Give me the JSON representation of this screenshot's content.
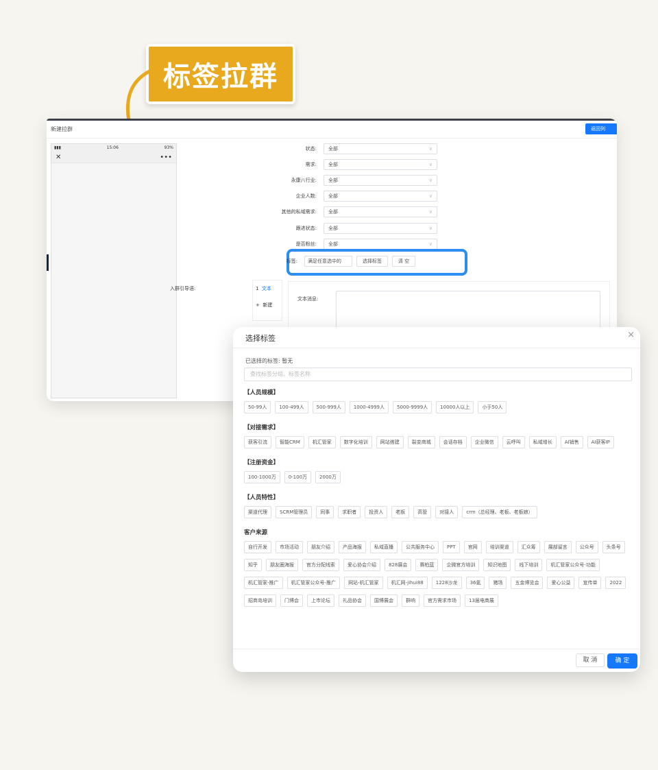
{
  "callout": {
    "text": "标签拉群"
  },
  "window": {
    "title": "新建拉群",
    "back_button": "返回列",
    "phone": {
      "time": "15:06",
      "battery": "93%",
      "close": "✕",
      "more": "•••"
    },
    "filters": [
      {
        "label": "状态:",
        "value": "全部"
      },
      {
        "label": "需求:",
        "value": "全部"
      },
      {
        "label": "永康八行业:",
        "value": "全部"
      },
      {
        "label": "企业人数:",
        "value": "全部"
      },
      {
        "label": "其他的私域需求:",
        "value": "全部"
      },
      {
        "label": "跟进状态:",
        "value": "全部"
      },
      {
        "label": "是否粉丝:",
        "value": "全部"
      }
    ],
    "tag_row": {
      "label": "标签:",
      "mode": "满足任意选中的",
      "select_button": "选择标签",
      "clear_button": "清 空"
    },
    "guide": {
      "label": "入群引导语:",
      "item_index": "1",
      "item_type": "文本",
      "add_label": "新建",
      "text_label": "文本消息:"
    }
  },
  "dialog": {
    "title": "选择标签",
    "close": "×",
    "selected_label": "已选择的标签:",
    "selected_value": "暂无",
    "search_placeholder": "查找标签分组、标签名称",
    "groups": [
      {
        "name": "【人员规模】",
        "tags": [
          "50-99人",
          "100-499人",
          "500-999人",
          "1000-4999人",
          "5000-9999人",
          "10000人以上",
          "小于50人"
        ]
      },
      {
        "name": "【对接需求】",
        "tags": [
          "获客引流",
          "智能CRM",
          "机汇管家",
          "数字化培训",
          "网站搭建",
          "裂变商城",
          "会话存档",
          "企业微信",
          "云呼叫",
          "私域增长",
          "AI销售",
          "AI获客IP"
        ]
      },
      {
        "name": "【注册资金】",
        "tags": [
          "100-1000万",
          "0-100万",
          "2000万"
        ]
      },
      {
        "name": "【人员特性】",
        "tags": [
          "渠道代理",
          "SCRM管理员",
          "同事",
          "求职者",
          "投资人",
          "老板",
          "高管",
          "对接人",
          "crm（总经理、老板、老板娘）"
        ]
      },
      {
        "name": "客户来源",
        "tags": [
          "自行开发",
          "市场活动",
          "朋友介绍",
          "产品海报",
          "私域直播",
          "公共服务中心",
          "PPT",
          "官网",
          "培训渠道",
          "汇众筹",
          "展部留言",
          "公众号",
          "头条号",
          "知乎",
          "朋友圈海报",
          "官方分配线索",
          "爱心协会介绍",
          "828展会",
          "赛柏蓝",
          "企微官方培训",
          "知识地图",
          "线下培训",
          "机汇管家公众号-功能",
          "机汇管家-推广",
          "机汇管家公众号-推广",
          "网站-机汇管家",
          "机汇网-jihui88",
          "1228沙龙",
          "36氪",
          "猪场",
          "五金博览会",
          "爱心公益",
          "宣传单",
          "2022",
          "招商岛培训",
          "门博会",
          "上市论坛",
          "礼品协会",
          "国博展会",
          "群响",
          "官方需求市场",
          "13届电商展"
        ]
      }
    ],
    "cancel": "取 消",
    "ok": "确 定"
  },
  "colors": {
    "accent": "#1677ff",
    "callout": "#e9a91f",
    "highlight_border": "#2b8ef0"
  }
}
